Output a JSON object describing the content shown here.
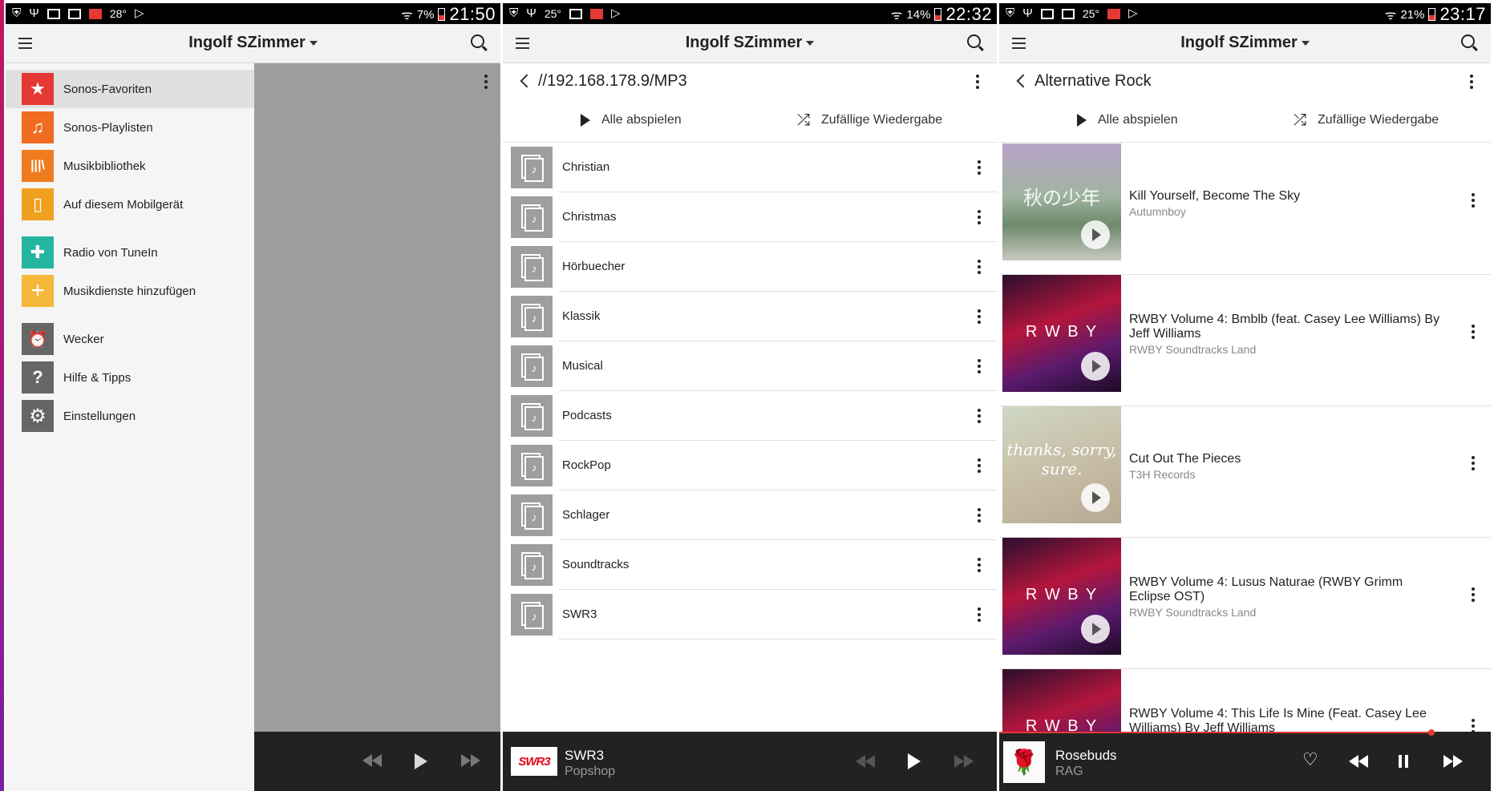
{
  "status": {
    "p1": {
      "temp": "28°",
      "battery": "7%",
      "time": "21:50"
    },
    "p2": {
      "temp": "25°",
      "battery": "14%",
      "time": "22:32"
    },
    "p3": {
      "temp": "25°",
      "battery": "21%",
      "time": "23:17"
    }
  },
  "room_name": "Ingolf SZimmer",
  "drawer": {
    "items": [
      {
        "label": "Sonos-Favoriten",
        "color": "#e53935",
        "icon": "star-icon",
        "glyph": "★"
      },
      {
        "label": "Sonos-Playlisten",
        "color": "#ef6c22",
        "icon": "playlist-icon",
        "glyph": "♫"
      },
      {
        "label": "Musikbibliothek",
        "color": "#ef7b1f",
        "icon": "library-icon",
        "glyph": "|||\\"
      },
      {
        "label": "Auf diesem Mobilgerät",
        "color": "#f0a020",
        "icon": "phone-icon",
        "glyph": "▯"
      },
      {
        "label": "Radio von TuneIn",
        "color": "#26b5a0",
        "icon": "tunein-icon",
        "glyph": "✚"
      },
      {
        "label": "Musikdienste hinzufügen",
        "color": "#f4b93a",
        "icon": "plus-icon",
        "glyph": "+"
      },
      {
        "label": "Wecker",
        "color": "#666666",
        "icon": "alarm-icon",
        "glyph": "⏰"
      },
      {
        "label": "Hilfe & Tipps",
        "color": "#666666",
        "icon": "help-icon",
        "glyph": "?"
      },
      {
        "label": "Einstellungen",
        "color": "#666666",
        "icon": "gear-icon",
        "glyph": "⚙"
      }
    ]
  },
  "folders": {
    "path": "//192.168.178.9/MP3",
    "play_all": "Alle abspielen",
    "shuffle": "Zufällige Wiedergabe",
    "items": [
      "Christian",
      "Christmas",
      "Hörbuecher",
      "Klassik",
      "Musical",
      "Podcasts",
      "RockPop",
      "Schlager",
      "Soundtracks",
      "SWR3"
    ]
  },
  "genre": {
    "title": "Alternative Rock",
    "play_all": "Alle abspielen",
    "shuffle": "Zufällige Wiedergabe",
    "tracks": [
      {
        "title": "Kill Yourself, Become The Sky",
        "artist": "Autumnboy",
        "art_text": "秋の少年"
      },
      {
        "title": "RWBY Volume 4: Bmblb (feat. Casey Lee Williams) By Jeff Williams",
        "artist": "RWBY Soundtracks Land",
        "art_text": "R W B Y"
      },
      {
        "title": "Cut Out The Pieces",
        "artist": "T3H Records",
        "art_text": "thanks, sorry, sure."
      },
      {
        "title": "RWBY Volume 4: Lusus Naturae (RWBY Grimm Eclipse OST)",
        "artist": "RWBY Soundtracks Land",
        "art_text": "R W B Y"
      },
      {
        "title": "RWBY Volume 4: This Life Is Mine (Feat. Casey Lee Williams) By Jeff Williams",
        "artist": "",
        "art_text": "R W B Y"
      }
    ]
  },
  "now_playing_p2": {
    "title": "SWR3",
    "subtitle": "Popshop",
    "logo": "SWR3"
  },
  "now_playing_p3": {
    "title": "Rosebuds",
    "subtitle": "RAG",
    "progress_fraction": 0.88
  },
  "colors": {
    "accent_red": "#e53935",
    "bar_bg": "#222222",
    "toolbar_bg": "#f2f2f2"
  }
}
